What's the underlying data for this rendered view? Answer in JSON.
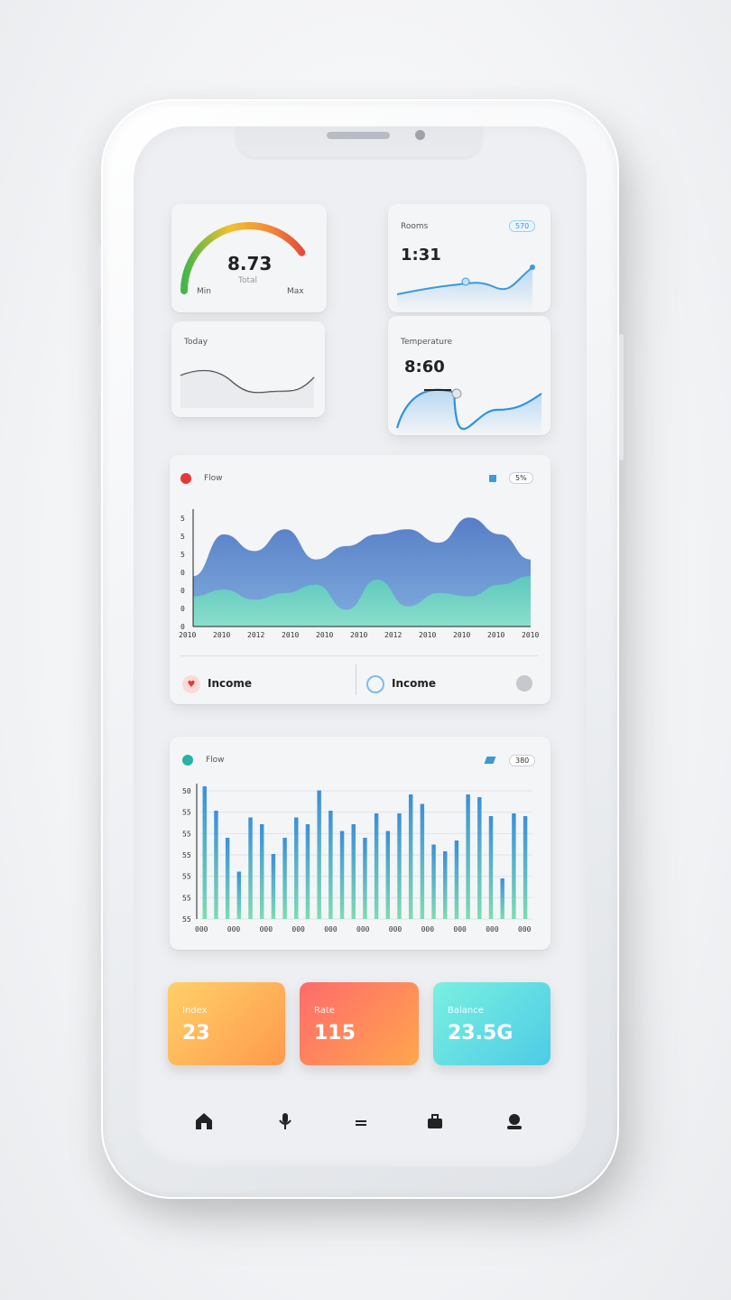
{
  "gauge": {
    "value": "8.73",
    "sub": "Total",
    "left": "Min",
    "right": "Max",
    "level": 0.8
  },
  "card2": {
    "title": "Rooms",
    "value": "1:31",
    "badge": "570"
  },
  "card3": {
    "title": "Today"
  },
  "card4": {
    "title": "Temperature",
    "value": "8:60"
  },
  "areaChart": {
    "title": "Flow",
    "badge": "5%",
    "footer_left": "Income",
    "footer_right": "Income",
    "chart_data": {
      "type": "area",
      "x": [
        "2010",
        "2010",
        "2012",
        "2010",
        "2010",
        "2010",
        "2012",
        "2010",
        "2010",
        "2010",
        "2010"
      ],
      "yTicks": [
        "5",
        "5",
        "5",
        "0",
        "0",
        "0",
        "0"
      ],
      "series": [
        {
          "values": [
            30,
            55,
            45,
            58,
            40,
            48,
            55,
            58,
            50,
            65,
            55,
            40
          ]
        },
        {
          "values": [
            18,
            22,
            16,
            20,
            25,
            10,
            28,
            12,
            20,
            18,
            25,
            30
          ]
        }
      ],
      "colors": [
        "#4f77c4",
        "#5ad1b8"
      ]
    }
  },
  "barChart": {
    "title": "Flow",
    "badge": "380",
    "chart_data": {
      "type": "bar",
      "x": [
        "000",
        "000",
        "000",
        "000",
        "000",
        "000",
        "000",
        "000",
        "000",
        "000",
        "000"
      ],
      "yTicks": [
        "50",
        "55",
        "55",
        "55",
        "55",
        "55",
        "55"
      ],
      "values": [
        98,
        80,
        60,
        35,
        75,
        70,
        48,
        60,
        75,
        70,
        95,
        80,
        65,
        70,
        60,
        78,
        65,
        78,
        92,
        85,
        55,
        50,
        58,
        92,
        90,
        76,
        30,
        78,
        76
      ],
      "colors": [
        "#3a8fdc",
        "#7ddcb2"
      ]
    }
  },
  "stats": [
    {
      "label": "Index",
      "value": "23",
      "from": "#ffd069",
      "to": "#ff9a4c"
    },
    {
      "label": "Rate",
      "value": "115",
      "from": "#ff6b6b",
      "to": "#ffa64d"
    },
    {
      "label": "Balance",
      "value": "23.5G",
      "from": "#79f0e0",
      "to": "#4ecbe6"
    }
  ],
  "nav": [
    "home-icon",
    "mic-icon",
    "menu-icon",
    "briefcase-icon",
    "profile-icon"
  ]
}
